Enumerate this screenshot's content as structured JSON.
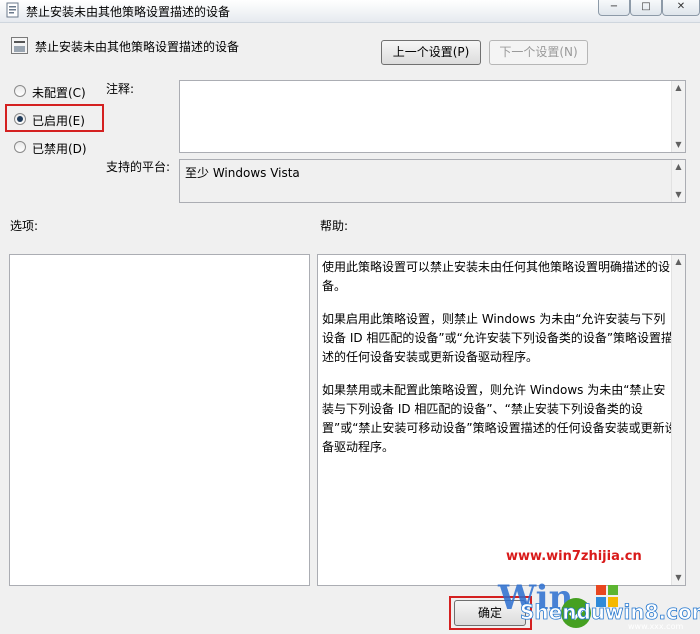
{
  "window": {
    "title": "禁止安装未由其他策略设置描述的设备",
    "controls": {
      "minimize": "−",
      "maximize": "□",
      "close": "✕"
    }
  },
  "header": {
    "policy_name": "禁止安装未由其他策略设置描述的设备",
    "prev_button": "上一个设置(P)",
    "next_button": "下一个设置(N)"
  },
  "state_options": [
    {
      "label": "未配置(C)",
      "checked": false
    },
    {
      "label": "已启用(E)",
      "checked": true
    },
    {
      "label": "已禁用(D)",
      "checked": false
    }
  ],
  "comment": {
    "label": "注释:",
    "value": ""
  },
  "platform": {
    "label": "支持的平台:",
    "value": "至少 Windows Vista"
  },
  "options": {
    "label": "选项:"
  },
  "help": {
    "label": "帮助:",
    "paragraphs": [
      "使用此策略设置可以禁止安装未由任何其他策略设置明确描述的设备。",
      "如果启用此策略设置，则禁止 Windows 为未由“允许安装与下列设备 ID 相匹配的设备”或“允许安装下列设备类的设备”策略设置描述的任何设备安装或更新设备驱动程序。",
      "如果禁用或未配置此策略设置，则允许 Windows 为未由“禁止安装与下列设备 ID 相匹配的设备”、“禁止安装下列设备类的设置”或“禁止安装可移动设备”策略设置描述的任何设备安装或更新设备驱动程序。"
    ]
  },
  "footer": {
    "ok_button": "确定"
  },
  "watermark": {
    "url": "www.win7zhijia.cn",
    "logo_text": "Shenduwin8.com",
    "logo_letters": "Win"
  },
  "colors": {
    "highlight": "#d42020",
    "window_bg": "#f0f0f0"
  },
  "icons": [
    "policy-icon",
    "minimize-icon",
    "maximize-icon",
    "close-icon"
  ]
}
